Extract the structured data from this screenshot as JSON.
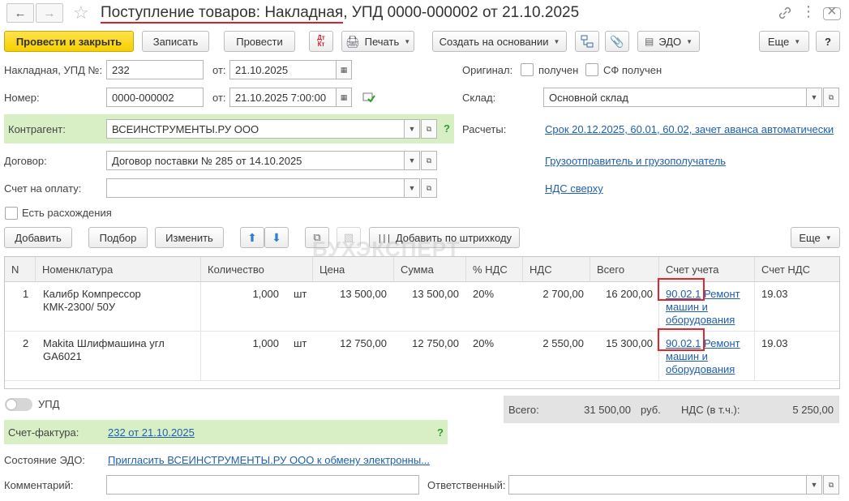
{
  "window": {
    "title_part1": "Поступление товаров: Накладная",
    "title_part2": ", УПД 0000-000002 от 21.10.2025"
  },
  "toolbar": {
    "post_close": "Провести и закрыть",
    "save": "Записать",
    "post": "Провести",
    "dtkt": "Дт Кт",
    "print": "Печать",
    "create_based": "Создать на основании",
    "edo": "ЭДО",
    "more": "Еще",
    "help": "?"
  },
  "form": {
    "invoice_label": "Накладная, УПД №:",
    "invoice_number": "232",
    "from_label": "от:",
    "invoice_date": "21.10.2025",
    "number_label": "Номер:",
    "number_value": "0000-000002",
    "doc_datetime": "21.10.2025  7:00:00",
    "original_label": "Оригинал:",
    "received_label": "получен",
    "sf_received_label": "СФ получен",
    "warehouse_label": "Склад:",
    "warehouse_value": "Основной склад",
    "counterparty_label": "Контрагент:",
    "counterparty_value": "ВСЕИНСТРУМЕНТЫ.РУ ООО",
    "settlements_label": "Расчеты:",
    "settlements_link": "Срок 20.12.2025, 60.01, 60.02, зачет аванса автоматически",
    "contract_label": "Договор:",
    "contract_value": "Договор поставки № 285 от 14.10.2025",
    "shipper_link": "Грузоотправитель и грузополучатель",
    "payment_invoice_label": "Счет на оплату:",
    "payment_invoice_value": "",
    "vat_link": "НДС сверху",
    "discrepancies_label": "Есть расхождения",
    "q": "?"
  },
  "table_toolbar": {
    "add": "Добавить",
    "pick": "Подбор",
    "edit": "Изменить",
    "barcode": "Добавить по штрихкоду",
    "more": "Еще"
  },
  "watermark": "БУХЭКСПЕРТ",
  "table": {
    "headers": [
      "N",
      "Номенклатура",
      "Количество",
      "Цена",
      "Сумма",
      "% НДС",
      "НДС",
      "Всего",
      "Счет учета",
      "Счет НДС"
    ],
    "rows": [
      {
        "n": "1",
        "name_line1": "Калибр Компрессор",
        "name_line2": "КМК-2300/ 50У",
        "qty": "1,000",
        "unit": "шт",
        "price": "13 500,00",
        "sum": "13 500,00",
        "vat_rate": "20%",
        "vat": "2 700,00",
        "total": "16 200,00",
        "account": "90.02.1",
        "account_desc_1": "Ремонт",
        "account_desc_2": "машин и",
        "account_desc_3": "оборудования",
        "vat_account": "19.03"
      },
      {
        "n": "2",
        "name_line1": "Makita Шлифмашина угл",
        "name_line2": "GA6021",
        "qty": "1,000",
        "unit": "шт",
        "price": "12 750,00",
        "sum": "12 750,00",
        "vat_rate": "20%",
        "vat": "2 550,00",
        "total": "15 300,00",
        "account": "90.02.1",
        "account_desc_1": "Ремонт",
        "account_desc_2": "машин и",
        "account_desc_3": "оборудования",
        "vat_account": "19.03"
      }
    ]
  },
  "footer": {
    "upd_label": "УПД",
    "total_label": "Всего:",
    "total_value": "31 500,00",
    "currency": "руб.",
    "vat_incl_label": "НДС (в т.ч.):",
    "vat_incl_value": "5 250,00",
    "sf_label": "Счет-фактура:",
    "sf_link": "232 от 21.10.2025",
    "edo_state_label": "Состояние ЭДО:",
    "edo_state_link": "Пригласить ВСЕИНСТРУМЕНТЫ.РУ ООО к обмену электронны...",
    "comment_label": "Комментарий:",
    "comment_value": "",
    "responsible_label": "Ответственный:",
    "responsible_value": ""
  },
  "colors": {
    "primary_button": "#f6cf00",
    "green_highlight": "#d8efc6",
    "link": "#1f5fae",
    "annotation_red": "#e0272e"
  }
}
